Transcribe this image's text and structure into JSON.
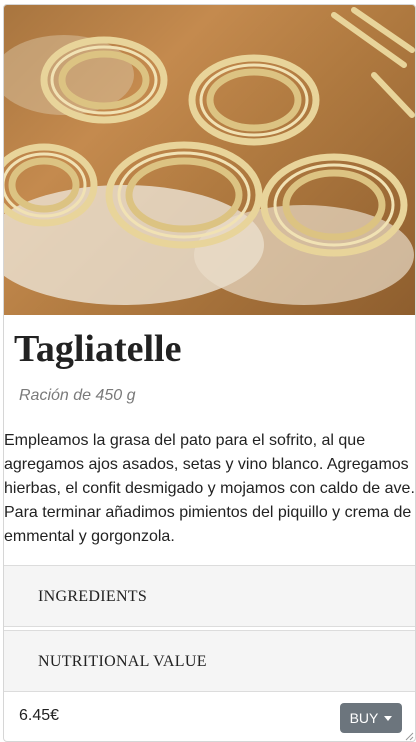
{
  "product": {
    "image_alt": "tagliatelle-nests-photo",
    "title": "Tagliatelle",
    "portion": "Ración de 450 g",
    "description": "Empleamos la grasa del pato para el sofrito, al que agregamos ajos asados, setas y vino blanco. Agregamos hierbas, el confit desmigado y mojamos con caldo de ave. Para terminar añadimos pimientos del piquillo y crema de emmental y gorgonzola."
  },
  "accordion": [
    {
      "label": "INGREDIENTS"
    },
    {
      "label": "NUTRITIONAL VALUE"
    }
  ],
  "footer": {
    "price": "6.45€",
    "buy_label": "BUY",
    "buy_icon": "caret-down-icon",
    "button_color": "#6c757d"
  }
}
